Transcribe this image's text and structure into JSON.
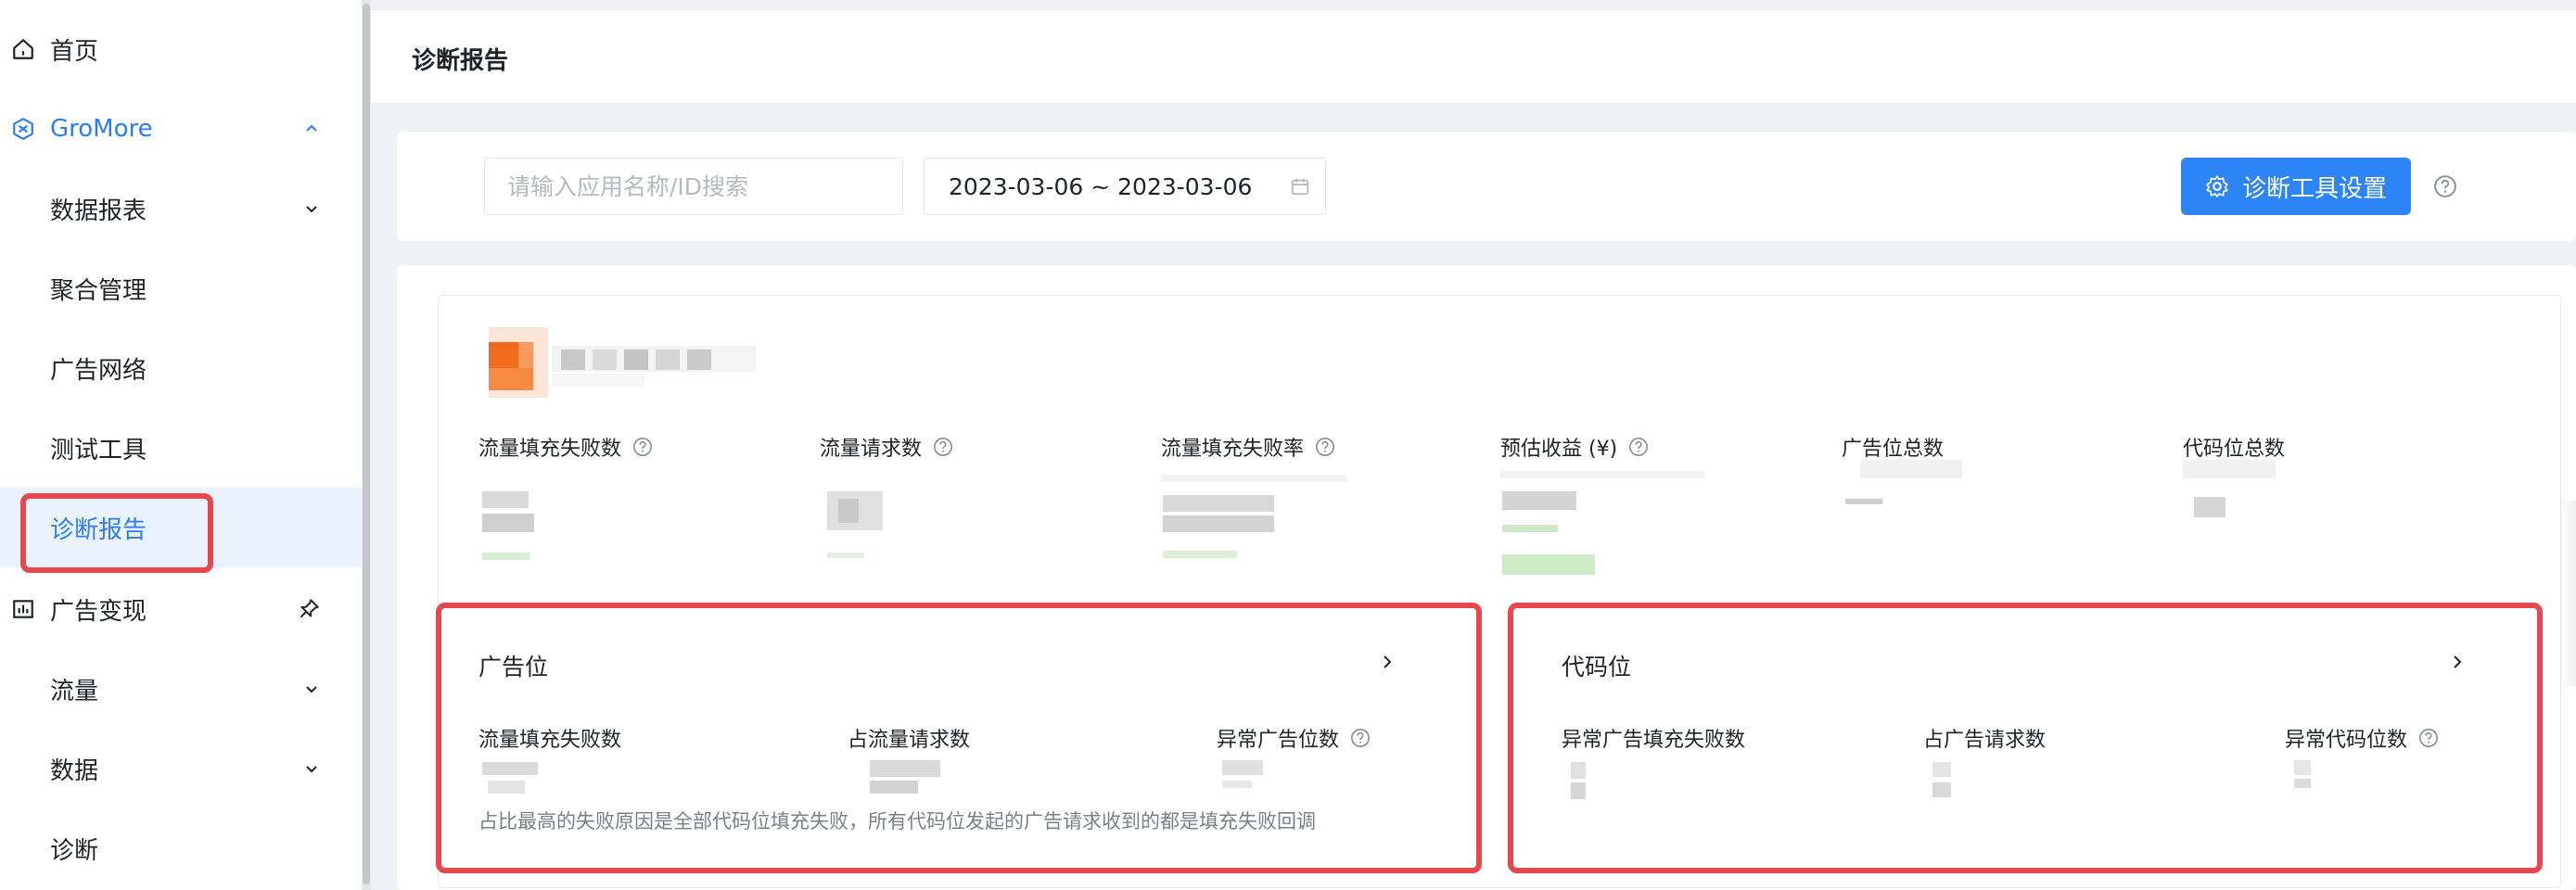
{
  "sidebar": {
    "items": [
      {
        "label": "首页",
        "icon": "home-icon"
      },
      {
        "label": "GroMore",
        "icon": "gromore-icon",
        "expanded": true
      },
      {
        "label": "数据报表",
        "has_submenu": true
      },
      {
        "label": "聚合管理"
      },
      {
        "label": "广告网络"
      },
      {
        "label": "测试工具"
      },
      {
        "label": "诊断报告",
        "selected": true
      },
      {
        "label": "广告变现",
        "icon": "chart-icon"
      },
      {
        "label": "流量",
        "has_submenu": true
      },
      {
        "label": "数据",
        "has_submenu": true
      },
      {
        "label": "诊断"
      }
    ]
  },
  "header": {
    "title": "诊断报告"
  },
  "filters": {
    "search_placeholder": "请输入应用名称/ID搜索",
    "date_range": "2023-03-06 ~ 2023-03-06",
    "tool_button": "诊断工具设置"
  },
  "summary": {
    "metrics": [
      {
        "label": "流量填充失败数",
        "help": true
      },
      {
        "label": "流量请求数",
        "help": true
      },
      {
        "label": "流量填充失败率",
        "help": true
      },
      {
        "label": "预估收益 (¥)",
        "help": true
      },
      {
        "label": "广告位总数",
        "help": false
      },
      {
        "label": "代码位总数",
        "help": false
      }
    ]
  },
  "ad_slot_card": {
    "title": "广告位",
    "labels": [
      "流量填充失败数",
      "占流量请求数",
      "异常广告位数"
    ],
    "note": "占比最高的失败原因是全部代码位填充失败，所有代码位发起的广告请求收到的都是填充失败回调"
  },
  "code_slot_card": {
    "title": "代码位",
    "labels": [
      "异常广告填充失败数",
      "占广告请求数",
      "异常代码位数"
    ]
  },
  "colors": {
    "accent": "#2d84f7",
    "annotation": "#e5484d",
    "selected_bg": "#eaf2fe",
    "logo": "#f26b1d"
  }
}
